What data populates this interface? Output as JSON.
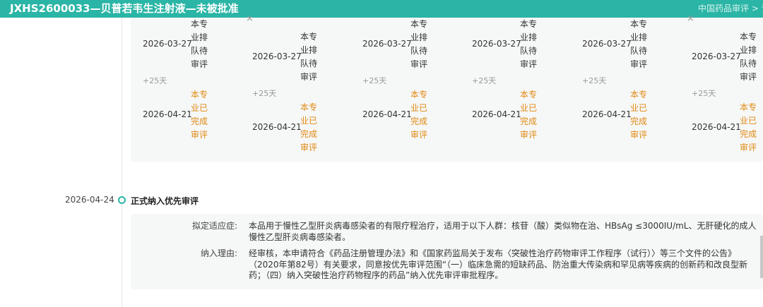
{
  "header": {
    "title": "JXHS2600033—贝普若韦生注射液—未被批准",
    "breadcrumb": "中国药品审评 > 详"
  },
  "stages": [
    {
      "queued_date": "2026-03-27",
      "queued_status": "本专业排队待审评",
      "duration": "+25天",
      "done_date": "2026-04-21",
      "done_status": "本专业已完成审评"
    },
    {
      "queued_date": "2026-03-27",
      "queued_status": "本专业排队待审评",
      "duration": "+25天",
      "done_date": "2026-04-21",
      "done_status": "本专业已完成审评"
    },
    {
      "queued_date": "2026-03-27",
      "queued_status": "本专业排队待审评",
      "duration": "+25天",
      "done_date": "2026-04-21",
      "done_status": "本专业已完成审评"
    },
    {
      "queued_date": "2026-03-27",
      "queued_status": "本专业排队待审评",
      "duration": "+25天",
      "done_date": "2026-04-21",
      "done_status": "本专业已完成审评"
    },
    {
      "queued_date": "2026-03-27",
      "queued_status": "本专业排队待审评",
      "duration": "+25天",
      "done_date": "2026-04-21",
      "done_status": "本专业已完成审评"
    },
    {
      "queued_date": "2026-03-27",
      "queued_status": "本专业排队待审评",
      "duration": "+25天",
      "done_date": "2026-04-21",
      "done_status": "本专业已完成审评"
    }
  ],
  "icons": {
    "column_close": "×"
  },
  "timeline_event": {
    "date": "2026-04-24",
    "title": "正式纳入优先审评",
    "indication_label": "拟定适应症:",
    "indication_value": "本品用于慢性乙型肝炎病毒感染者的有限疗程治疗，适用于以下人群：核苷（酸）类似物在治、HBsAg ≤3000IU/mL、无肝硬化的成人慢性乙型肝炎病毒感染者。",
    "reason_label": "纳入理由:",
    "reason_value": "经审核，本申请符合《药品注册管理办法》和《国家药监局关于发布〈突破性治疗药物审评工作程序（试行）〉等三个文件的公告》（2020年第82号）有关要求，同意按优先审评范围“（一）临床急需的短缺药品、防治重大传染病和罕见病等疾病的创新药和改良型新药；（四）纳入突破性治疗药物程序的药品”纳入优先审评审批程序。"
  },
  "colors": {
    "accent": "#2bb5a6",
    "done_status": "#e08a12",
    "card_bg": "#f6f7f7"
  }
}
